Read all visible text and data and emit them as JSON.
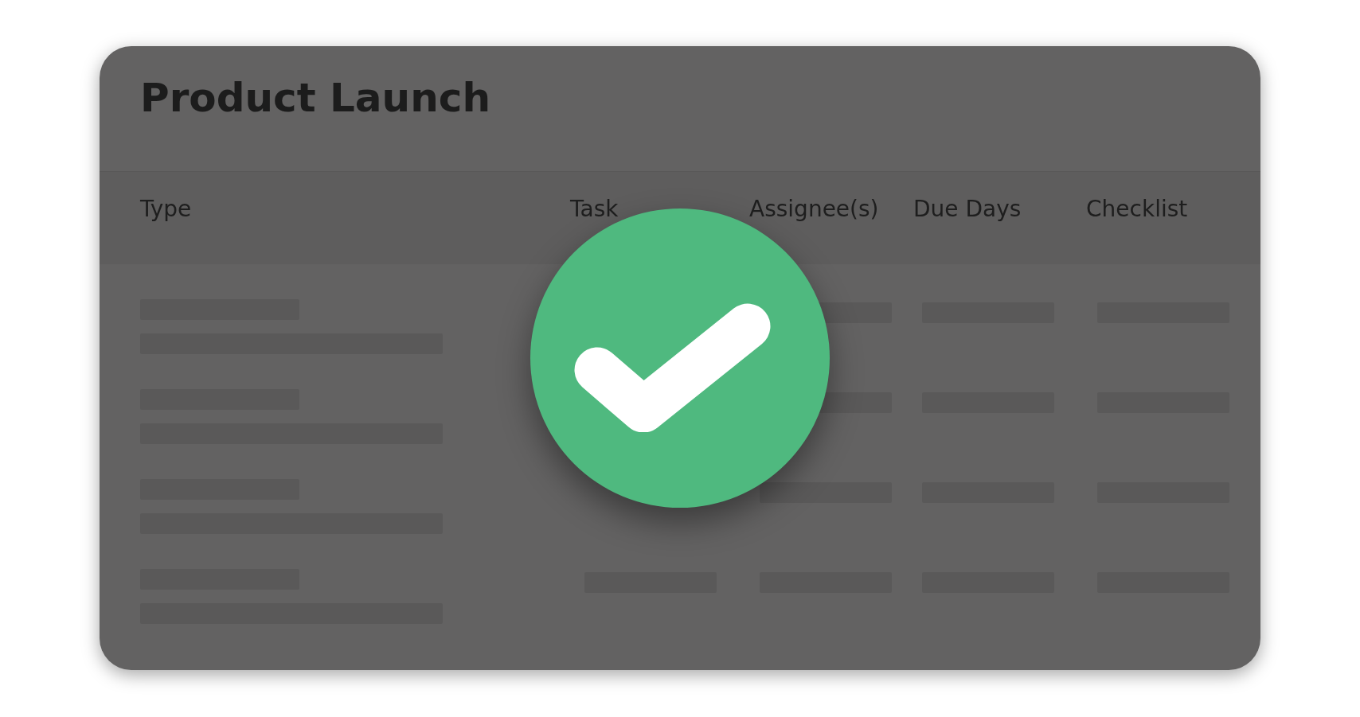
{
  "card": {
    "title": "Product Launch"
  },
  "table": {
    "columns": [
      "Type",
      "Task",
      "Assignee(s)",
      "Due Days",
      "Checklist"
    ],
    "rows": [
      {
        "kind": "partly_covered"
      },
      {
        "kind": "partly_covered"
      },
      {
        "kind": "partly_covered"
      },
      {
        "kind": "placeholder"
      }
    ]
  },
  "overlay": {
    "kind": "success"
  }
}
